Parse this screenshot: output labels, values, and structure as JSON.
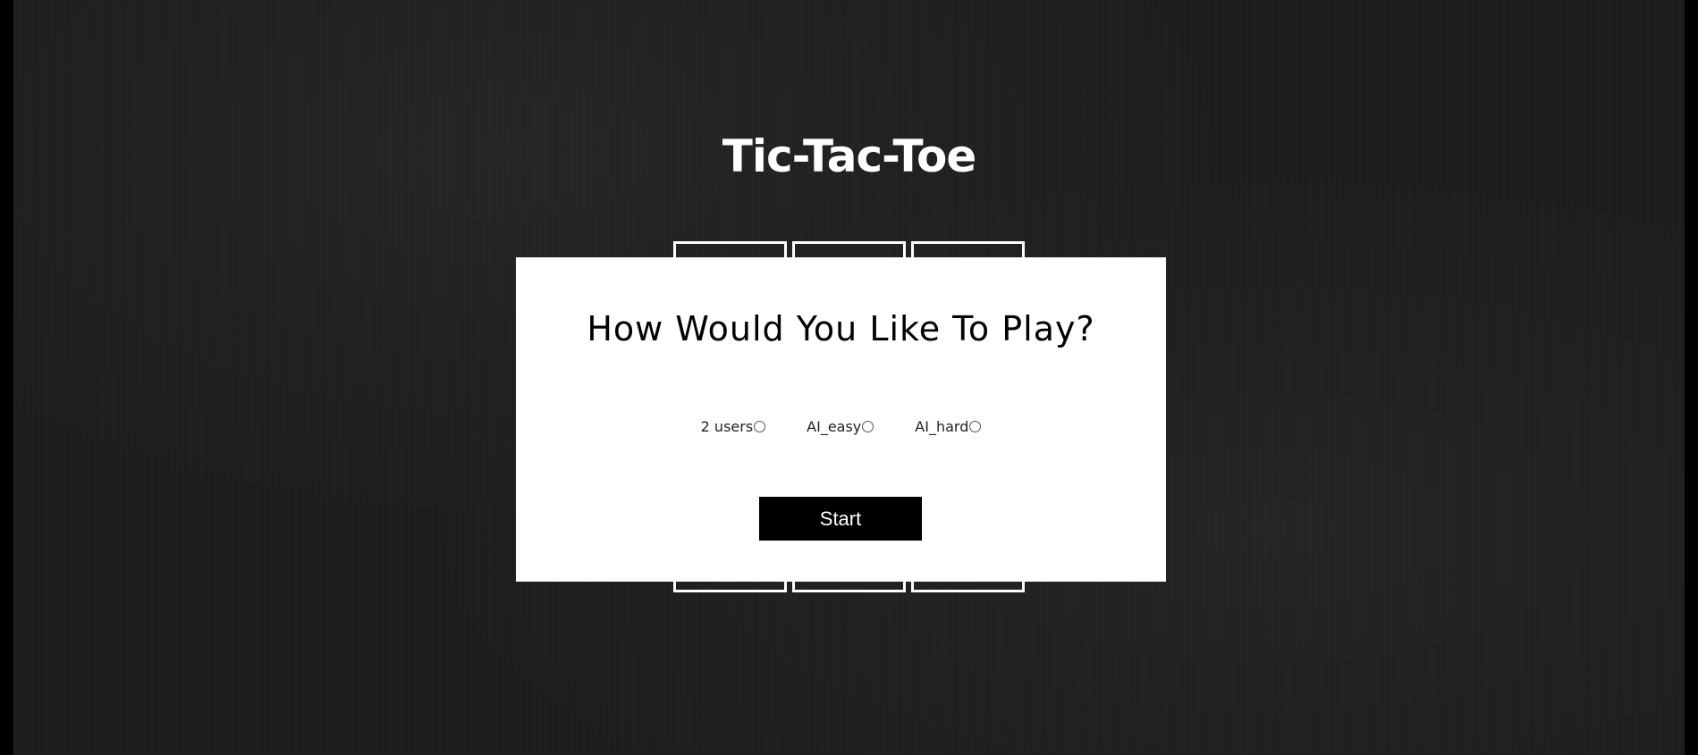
{
  "game": {
    "title": "Tic-Tac-Toe"
  },
  "board": {
    "rows": 3,
    "cols": 3,
    "cells": [
      "",
      "",
      "",
      "",
      "",
      "",
      "",
      "",
      ""
    ]
  },
  "modal": {
    "heading": "How Would You Like To Play?",
    "options": [
      {
        "label": "2 users",
        "selected": false
      },
      {
        "label": "AI_easy",
        "selected": false
      },
      {
        "label": "AI_hard",
        "selected": false
      }
    ],
    "start_label": "Start"
  },
  "colors": {
    "background": "#1d1d1d",
    "chalk": "#ffffff",
    "modal_bg": "#ffffff",
    "button_bg": "#000000"
  }
}
